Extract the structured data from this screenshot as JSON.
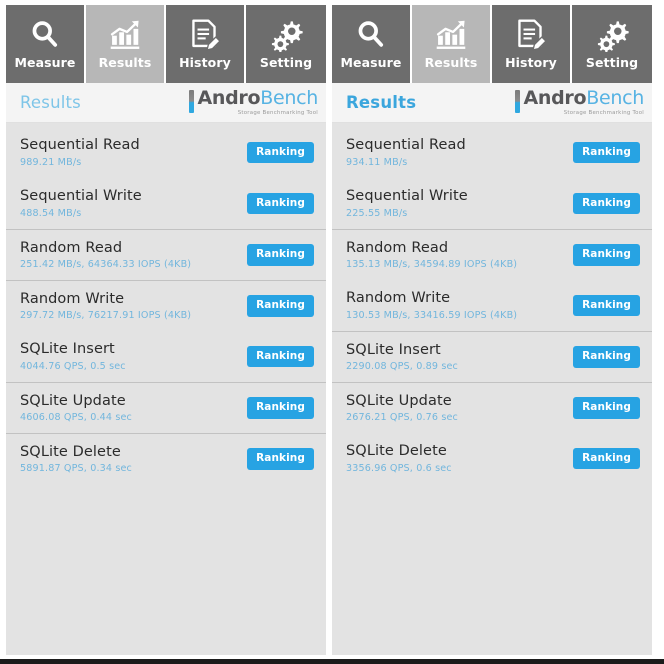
{
  "app": {
    "logo_primary": "Andro",
    "logo_secondary": "Bench",
    "logo_tagline": "Storage Benchmarking Tool",
    "accent_blue": "#27a3e3",
    "tabbar_bg": "#6d6d6d",
    "tab_active_bg": "#b7b7b7",
    "panel_bg": "#e3e3e3",
    "value_text_color": "#72b6dd"
  },
  "tabs": [
    {
      "label": "Measure",
      "icon": "magnifier-icon",
      "active": false
    },
    {
      "label": "Results",
      "icon": "bar-chart-icon",
      "active": true
    },
    {
      "label": "History",
      "icon": "document-pencil-icon",
      "active": false
    },
    {
      "label": "Setting",
      "icon": "gears-icon",
      "active": false
    }
  ],
  "panels": [
    {
      "title": "Results",
      "rows": [
        {
          "name": "Sequential Read",
          "value": "989.21 MB/s",
          "button": "Ranking",
          "separator": false
        },
        {
          "name": "Sequential Write",
          "value": "488.54 MB/s",
          "button": "Ranking",
          "separator": false
        },
        {
          "name": "Random Read",
          "value": "251.42 MB/s, 64364.33 IOPS (4KB)",
          "button": "Ranking",
          "separator": true
        },
        {
          "name": "Random Write",
          "value": "297.72 MB/s, 76217.91 IOPS (4KB)",
          "button": "Ranking",
          "separator": true
        },
        {
          "name": "SQLite Insert",
          "value": "4044.76 QPS, 0.5 sec",
          "button": "Ranking",
          "separator": false
        },
        {
          "name": "SQLite Update",
          "value": "4606.08 QPS, 0.44 sec",
          "button": "Ranking",
          "separator": true
        },
        {
          "name": "SQLite Delete",
          "value": "5891.87 QPS, 0.34 sec",
          "button": "Ranking",
          "separator": true
        }
      ]
    },
    {
      "title": "Results",
      "rows": [
        {
          "name": "Sequential Read",
          "value": "934.11 MB/s",
          "button": "Ranking",
          "separator": false
        },
        {
          "name": "Sequential Write",
          "value": "225.55 MB/s",
          "button": "Ranking",
          "separator": false
        },
        {
          "name": "Random Read",
          "value": "135.13 MB/s, 34594.89 IOPS (4KB)",
          "button": "Ranking",
          "separator": true
        },
        {
          "name": "Random Write",
          "value": "130.53 MB/s, 33416.59 IOPS (4KB)",
          "button": "Ranking",
          "separator": false
        },
        {
          "name": "SQLite Insert",
          "value": "2290.08 QPS, 0.89 sec",
          "button": "Ranking",
          "separator": true
        },
        {
          "name": "SQLite Update",
          "value": "2676.21 QPS, 0.76 sec",
          "button": "Ranking",
          "separator": true
        },
        {
          "name": "SQLite Delete",
          "value": "3356.96 QPS, 0.6 sec",
          "button": "Ranking",
          "separator": false
        }
      ]
    }
  ]
}
